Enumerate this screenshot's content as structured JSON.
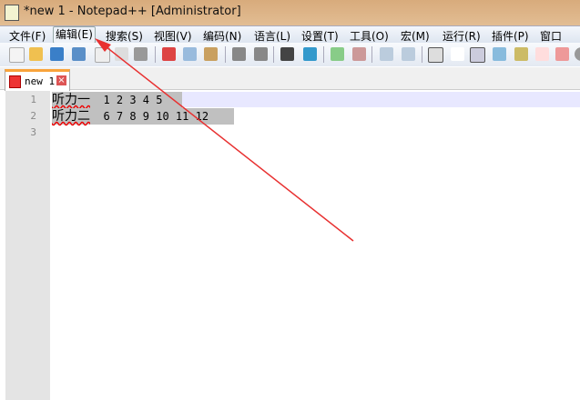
{
  "window": {
    "title": "*new 1 - Notepad++ [Administrator]"
  },
  "menu": [
    "文件(F)",
    "编辑(E)",
    "搜索(S)",
    "视图(V)",
    "编码(N)",
    "语言(L)",
    "设置(T)",
    "工具(O)",
    "宏(M)",
    "运行(R)",
    "插件(P)",
    "窗口(W)"
  ],
  "tab": {
    "label": "new 1",
    "close": "×"
  },
  "lines": [
    {
      "num": "1",
      "cjk": "听力一",
      "rest": "  1 2 3 4 5"
    },
    {
      "num": "2",
      "cjk": "听力二",
      "rest": "  6 7 8 9 10 11 12"
    },
    {
      "num": "3",
      "cjk": "",
      "rest": ""
    }
  ],
  "colors": {
    "arrow": "#e83030",
    "selection": "#c0c0c0",
    "current_line": "#e8e8ff"
  }
}
